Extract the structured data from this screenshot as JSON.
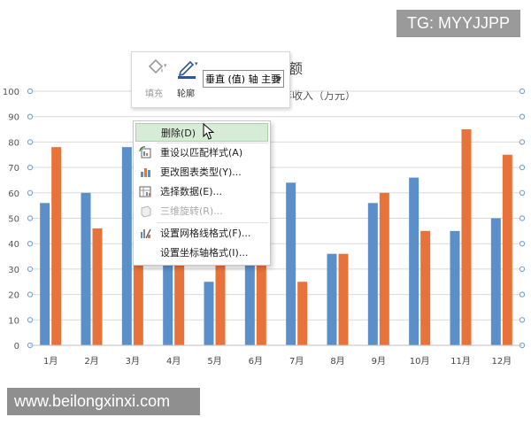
{
  "watermarks": {
    "top": "TG: MYYJJPP",
    "bottom": "www.beilongxinxi.com"
  },
  "colors": {
    "series_blue": "#5b8fc9",
    "series_orange": "#e8733a",
    "gridline": "#d9d9d9",
    "handle": "#7ea6d2",
    "menu_hover": "#d6ecd6"
  },
  "toolbar": {
    "fill_label": "填充",
    "outline_label": "轮廓",
    "element_select": "垂直 (值) 轴 主要",
    "icons": {
      "fill": "paint-bucket-icon",
      "outline": "pen-outline-icon"
    }
  },
  "chart_title_visible": "额",
  "chart_subtitle_visible": "年收入（万元）",
  "context_menu": {
    "items": [
      {
        "label": "删除(D)",
        "icon": "",
        "state": "hover"
      },
      {
        "label": "重设以匹配样式(A)",
        "icon": "reset-style-icon",
        "state": "normal"
      },
      {
        "label": "更改图表类型(Y)...",
        "icon": "chart-type-icon",
        "state": "normal"
      },
      {
        "label": "选择数据(E)...",
        "icon": "select-data-icon",
        "state": "normal"
      },
      {
        "label": "三维旋转(R)...",
        "icon": "3d-rotate-icon",
        "state": "disabled"
      },
      {
        "label": "设置网格线格式(F)...",
        "icon": "gridline-format-icon",
        "state": "normal"
      },
      {
        "label": "设置坐标轴格式(I)...",
        "icon": "",
        "state": "normal"
      }
    ]
  },
  "chart_data": {
    "type": "bar",
    "categories": [
      "1月",
      "2月",
      "3月",
      "4月",
      "5月",
      "6月",
      "7月",
      "8月",
      "9月",
      "10月",
      "11月",
      "12月"
    ],
    "series": [
      {
        "values": [
          56,
          60,
          78,
          33,
          25,
          33,
          64,
          36,
          56,
          66,
          45,
          50
        ]
      },
      {
        "values": [
          78,
          46,
          33,
          33,
          33,
          33,
          25,
          36,
          60,
          45,
          85,
          75
        ]
      }
    ],
    "ylim": [
      0,
      100
    ],
    "yticks": [
      0,
      10,
      20,
      30,
      40,
      50,
      60,
      70,
      80,
      90,
      100
    ],
    "grid": true,
    "legend": "none"
  }
}
